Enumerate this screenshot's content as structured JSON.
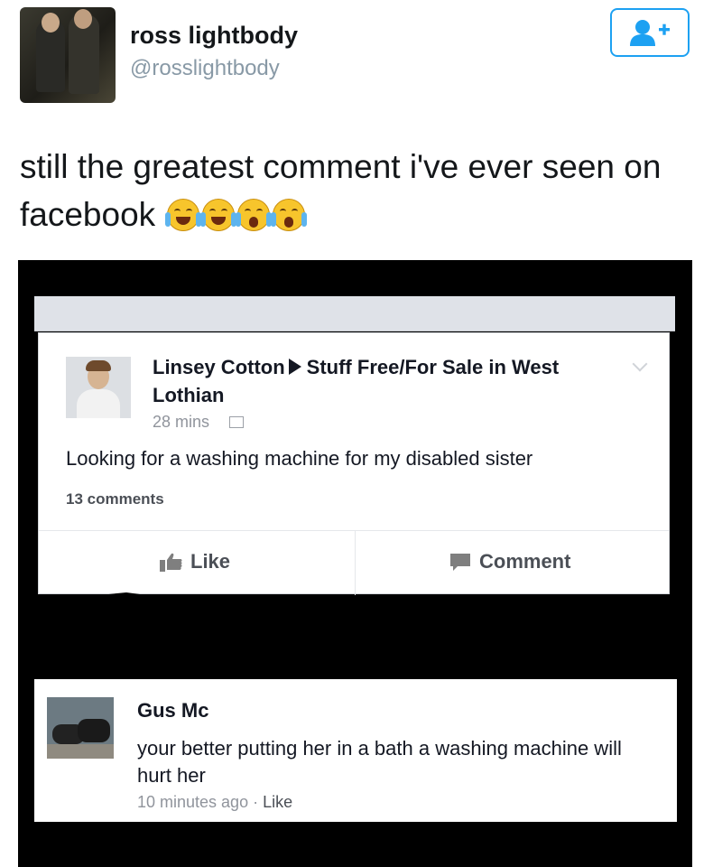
{
  "user": {
    "name": "ross lightbody",
    "handle": "@rosslightbody"
  },
  "tweet": {
    "text": "still the greatest comment i've ever seen on facebook",
    "emojis": [
      "face-with-tears-of-joy",
      "face-with-tears-of-joy",
      "loudly-crying-face",
      "loudly-crying-face"
    ]
  },
  "accent_color": "#1da1f2",
  "fb_post": {
    "author": "Linsey Cotton",
    "group": "Stuff Free/For Sale in West Lothian",
    "time": "28 mins",
    "body": "Looking for a washing machine for my disabled sister",
    "comments_count": "13 comments",
    "like_label": "Like",
    "comment_label": "Comment"
  },
  "fb_comment": {
    "author": "Gus Mc",
    "text": "your better putting her in a bath a washing machine will hurt her",
    "time": "10 minutes ago",
    "separator": "·",
    "like_label": "Like"
  }
}
